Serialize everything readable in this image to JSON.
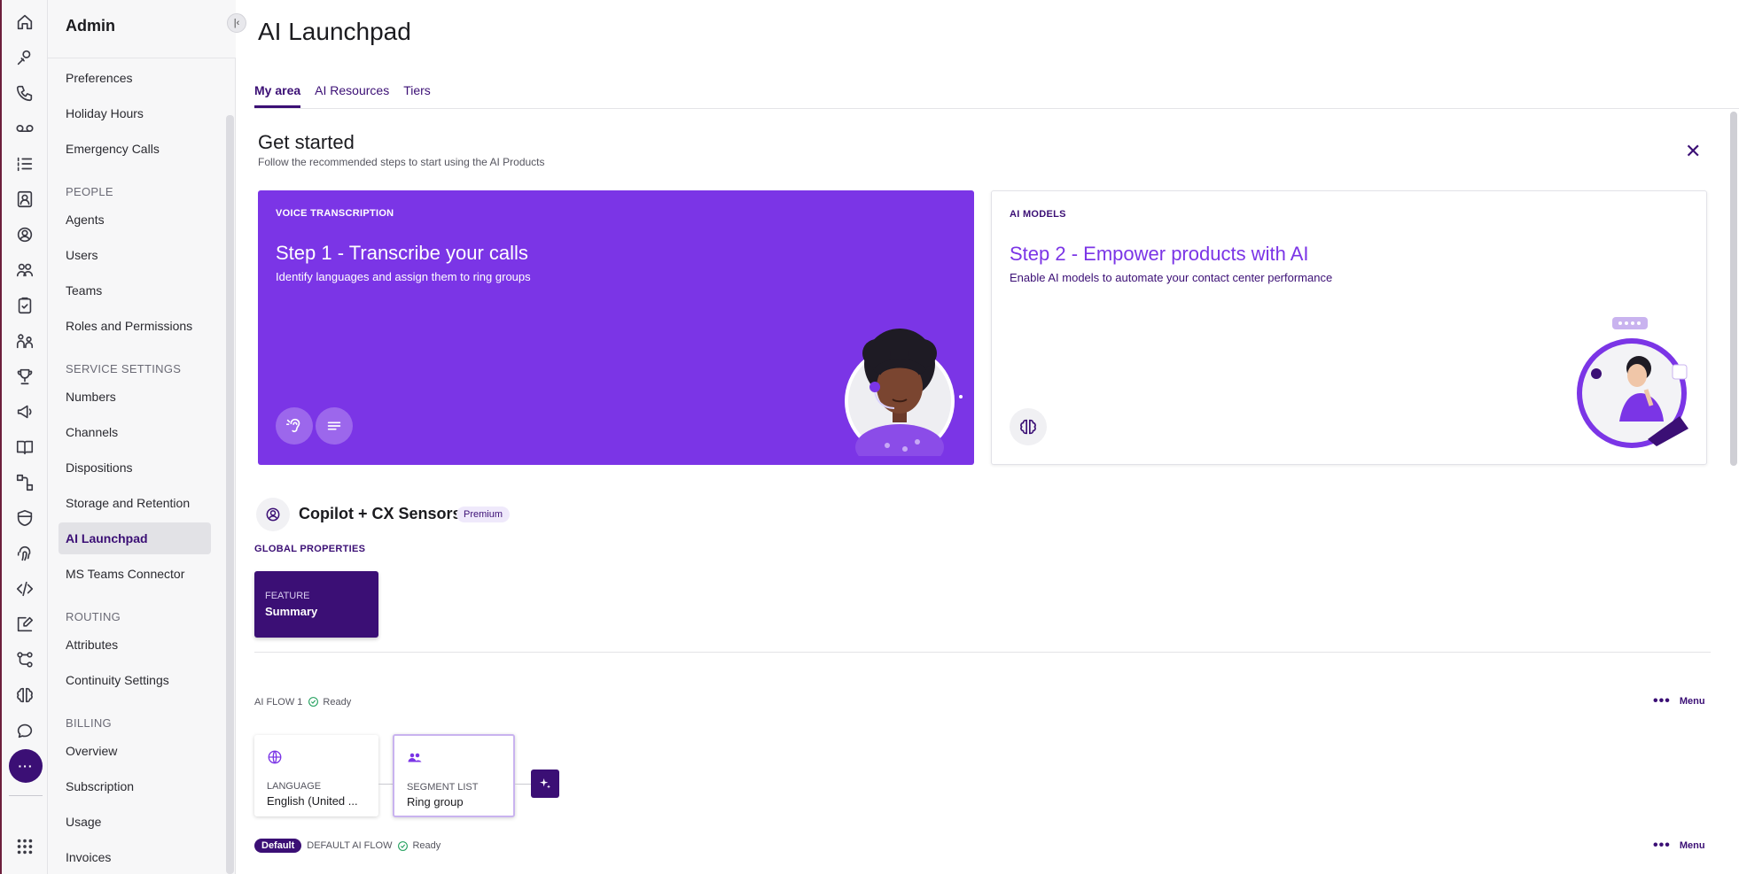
{
  "rail": {
    "icons": [
      "home-icon",
      "agent-support-icon",
      "phone-icon",
      "voicemail-icon",
      "list-icon",
      "contact-book-icon",
      "headset-icon",
      "team-icon",
      "clipboard-icon",
      "people-network-icon",
      "trophy-icon",
      "megaphone-icon",
      "book-icon",
      "flow-icon",
      "shield-icon",
      "fingerprint-icon",
      "code-icon",
      "edit-icon",
      "workflow-icon",
      "brain-icon",
      "chat-icon"
    ],
    "more_label": "···",
    "apps_icon": "apps-grid-icon"
  },
  "nav": {
    "title": "Admin",
    "collapse_icon": "collapse-left-icon",
    "items_top": [
      "Preferences",
      "Holiday Hours",
      "Emergency Calls"
    ],
    "sections": {
      "people": {
        "label": "PEOPLE",
        "items": [
          "Agents",
          "Users",
          "Teams",
          "Roles and Permissions"
        ]
      },
      "service": {
        "label": "SERVICE SETTINGS",
        "items": [
          "Numbers",
          "Channels",
          "Dispositions",
          "Storage and Retention",
          "AI Launchpad",
          "MS Teams Connector"
        ]
      },
      "routing": {
        "label": "ROUTING",
        "items": [
          "Attributes",
          "Continuity Settings"
        ]
      },
      "billing": {
        "label": "BILLING",
        "items": [
          "Overview",
          "Subscription",
          "Usage",
          "Invoices"
        ]
      }
    },
    "active_item": "AI Launchpad"
  },
  "page": {
    "title": "AI Launchpad",
    "tabs": [
      "My area",
      "AI Resources",
      "Tiers"
    ],
    "active_tab": "My area"
  },
  "get_started": {
    "title": "Get started",
    "subtitle": "Follow the recommended steps to start using the AI Products",
    "close_icon": "close-icon",
    "cards": [
      {
        "kicker": "VOICE TRANSCRIPTION",
        "step": "Step 1 - Transcribe your calls",
        "desc": "Identify languages and assign them to ring groups",
        "color": "#7b35e6"
      },
      {
        "kicker": "AI MODELS",
        "step": "Step 2 - Empower products with AI",
        "desc": "Enable AI models to automate your contact center performance"
      }
    ]
  },
  "copilot": {
    "title": "Copilot + CX Sensors",
    "badge": "Premium",
    "global_label": "GLOBAL PROPERTIES",
    "feature": {
      "kicker": "FEATURE",
      "value": "Summary"
    }
  },
  "flows": [
    {
      "label": "AI FLOW 1",
      "status": "Ready",
      "menu": "Menu",
      "language": {
        "kicker": "LANGUAGE",
        "value": "English (United ..."
      },
      "segment": {
        "kicker": "SEGMENT LIST",
        "value": "Ring group"
      }
    },
    {
      "badge": "Default",
      "label": "DEFAULT AI FLOW",
      "status": "Ready",
      "menu": "Menu"
    }
  ],
  "colors": {
    "accent": "#3b0f75",
    "brand_purple": "#7b35e6",
    "ready_green": "#1e9e5a"
  }
}
